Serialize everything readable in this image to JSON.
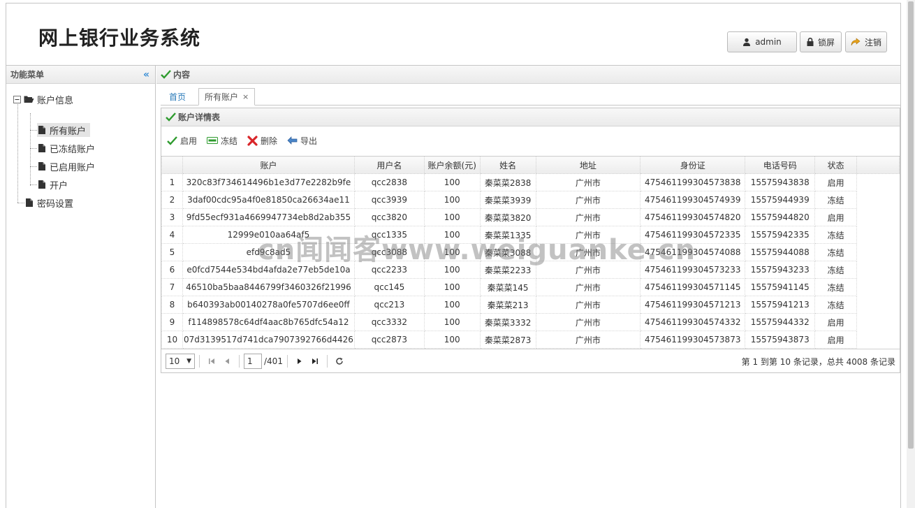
{
  "app": {
    "title": "网上银行业务系统"
  },
  "header_buttons": {
    "user": "admin",
    "lock": "锁屏",
    "logout": "注销"
  },
  "sidebar": {
    "title": "功能菜单",
    "root": "账户信息",
    "items": [
      {
        "label": "所有账户",
        "selected": true
      },
      {
        "label": "已冻结账户"
      },
      {
        "label": "已启用账户"
      },
      {
        "label": "开户"
      }
    ],
    "root2": "密码设置"
  },
  "content": {
    "panel_title": "内容",
    "tabs": [
      {
        "label": "首页"
      },
      {
        "label": "所有账户"
      }
    ],
    "grid_title": "账户详情表",
    "toolbar": {
      "enable": "启用",
      "freeze": "冻结",
      "delete": "删除",
      "export": "导出"
    },
    "columns": [
      "账户",
      "用户名",
      "账户余额(元)",
      "姓名",
      "地址",
      "身份证",
      "电话号码",
      "状态"
    ],
    "rows": [
      [
        "1",
        "320c83f734614496b1e3d77e2282b9fe",
        "qcc2838",
        "100",
        "秦菜菜2838",
        "广州市",
        "475461199304573838",
        "15575943838",
        "启用"
      ],
      [
        "2",
        "3daf00cdc95a4f0e81850ca26634ae11",
        "qcc3939",
        "100",
        "秦菜菜3939",
        "广州市",
        "475461199304574939",
        "15575944939",
        "冻结"
      ],
      [
        "3",
        "9fd55ecf931a4669947734eb8d2ab355",
        "qcc3820",
        "100",
        "秦菜菜3820",
        "广州市",
        "475461199304574820",
        "15575944820",
        "启用"
      ],
      [
        "4",
        "12999e010aa64af5",
        "qcc1335",
        "100",
        "秦菜菜1335",
        "广州市",
        "475461199304572335",
        "15575942335",
        "冻结"
      ],
      [
        "5",
        "efd9c8ad5",
        "qcc3088",
        "100",
        "秦菜菜3088",
        "广州市",
        "475461199304574088",
        "15575944088",
        "冻结"
      ],
      [
        "6",
        "e0fcd7544e534bd4afda2e77eb5de10a",
        "qcc2233",
        "100",
        "秦菜菜2233",
        "广州市",
        "475461199304573233",
        "15575943233",
        "冻结"
      ],
      [
        "7",
        "46510ba5baa8446799f3460326f21996",
        "qcc145",
        "100",
        "秦菜菜145",
        "广州市",
        "475461199304571145",
        "15575941145",
        "冻结"
      ],
      [
        "8",
        "b640393ab00140278a0fe5707d6ee0ff",
        "qcc213",
        "100",
        "秦菜菜213",
        "广州市",
        "475461199304571213",
        "15575941213",
        "冻结"
      ],
      [
        "9",
        "f114898578c64df4aac8b765dfc54a12",
        "qcc3332",
        "100",
        "秦菜菜3332",
        "广州市",
        "475461199304574332",
        "15575944332",
        "启用"
      ],
      [
        "10",
        "07d3139517d741dca7907392766d4426",
        "qcc2873",
        "100",
        "秦菜菜2873",
        "广州市",
        "475461199304573873",
        "15575943873",
        "启用"
      ]
    ],
    "pager": {
      "page_size": "10",
      "current_page": "1",
      "total_pages": "/401",
      "info": "第 1 到第 10 条记录，总共 4008 条记录"
    }
  },
  "watermark": "cn闻闻客www.weiguanke.cn",
  "colors": {
    "accent": "#2a7ab8",
    "check": "#2e9b2e",
    "delete": "#d9262a"
  }
}
